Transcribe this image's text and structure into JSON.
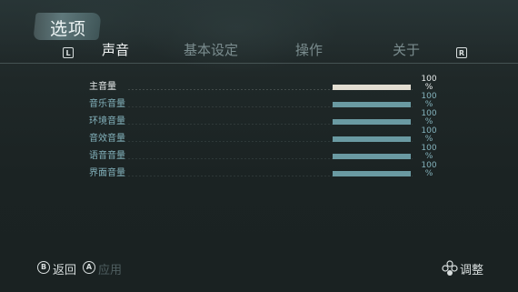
{
  "header": {
    "title": "选项",
    "left_bumper": "L",
    "right_bumper": "R",
    "tabs": [
      {
        "label": "声音",
        "active": true
      },
      {
        "label": "基本设定",
        "active": false
      },
      {
        "label": "操作",
        "active": false
      },
      {
        "label": "关于",
        "active": false
      }
    ]
  },
  "settings": [
    {
      "label": "主音量",
      "value": "100\n%",
      "level": 1.0,
      "active": true
    },
    {
      "label": "音乐音量",
      "value": "100\n%",
      "level": 1.0,
      "active": false
    },
    {
      "label": "环境音量",
      "value": "100\n%",
      "level": 1.0,
      "active": false
    },
    {
      "label": "音效音量",
      "value": "100\n%",
      "level": 1.0,
      "active": false
    },
    {
      "label": "语音音量",
      "value": "100\n%",
      "level": 1.0,
      "active": false
    },
    {
      "label": "界面音量",
      "value": "100\n%",
      "level": 1.0,
      "active": false
    }
  ],
  "footer": {
    "back_key": "B",
    "back_label": "返回",
    "apply_key": "A",
    "apply_label": "应用",
    "adjust_label": "调整"
  },
  "colors": {
    "accent": "#6a9aa2",
    "active_bar": "#e3ded2",
    "label": "#84b3bd"
  }
}
